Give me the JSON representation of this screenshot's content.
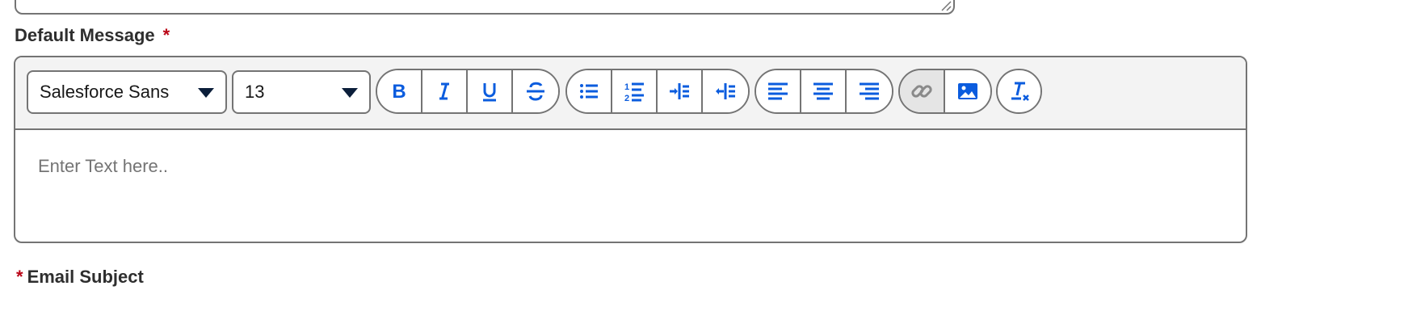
{
  "form": {
    "default_message": {
      "label": "Default Message",
      "required_mark": "*"
    },
    "email_subject": {
      "label": "Email Subject",
      "required_mark": "*"
    }
  },
  "toolbar": {
    "font_family": "Salesforce Sans",
    "font_size": "13",
    "format_buttons": [
      "bold-icon",
      "italic-icon",
      "underline-icon",
      "strikethrough-icon"
    ],
    "list_buttons": [
      "bulleted-list-icon",
      "numbered-list-icon",
      "indent-icon",
      "outdent-icon"
    ],
    "align_buttons": [
      "align-left-icon",
      "align-center-icon",
      "align-right-icon"
    ],
    "insert_buttons": [
      "link-icon",
      "image-icon"
    ],
    "clear_button": "remove-formatting-icon"
  },
  "editor": {
    "placeholder": "Enter Text here.."
  },
  "colors": {
    "accent": "#0b5cde",
    "required": "#ba0517",
    "border": "#747474",
    "toolbar_bg": "#f3f3f3"
  }
}
